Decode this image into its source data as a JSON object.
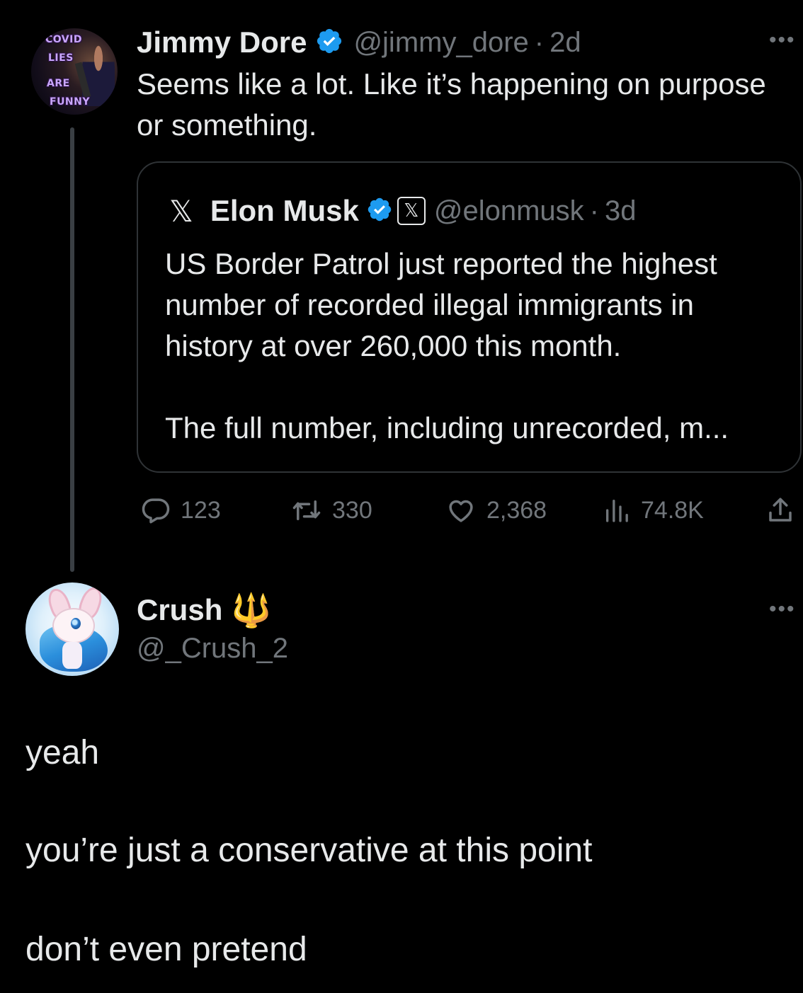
{
  "tweet": {
    "author": {
      "avatar_icon": "covid-lies-are-funny-avatar",
      "avatar_words": [
        "COVID",
        "LIES",
        "ARE",
        "FUNNY"
      ],
      "name": "Jimmy Dore",
      "verified_icon": "verified-badge-icon",
      "handle": "@jimmy_dore",
      "separator": "·",
      "time": "2d"
    },
    "more_label": "•••",
    "text": "Seems like a lot. Like it’s happening on purpose or something.",
    "quote": {
      "avatar_glyph": "𝕏",
      "name": "Elon Musk",
      "affiliate_glyph": "𝕏",
      "handle": "@elonmusk",
      "separator": "·",
      "time": "3d",
      "paragraph1": "US Border Patrol just reported the highest number of recorded illegal immigrants in history at over 260,000 this month.",
      "paragraph2": "The full number, including unrecorded, m..."
    },
    "actions": {
      "replies": "123",
      "reposts": "330",
      "likes": "2,368",
      "views": "74.8K"
    }
  },
  "reply": {
    "name": "Crush",
    "name_emoji": "🔱",
    "handle": "@_Crush_2",
    "more_label": "•••",
    "lines": [
      "yeah",
      "you’re just a conservative at this point",
      "don’t even pretend"
    ]
  },
  "colors": {
    "background": "#000000",
    "text": "#e7e9ea",
    "muted": "#71767b",
    "verified": "#1d9bf0",
    "border": "#2f3336"
  }
}
